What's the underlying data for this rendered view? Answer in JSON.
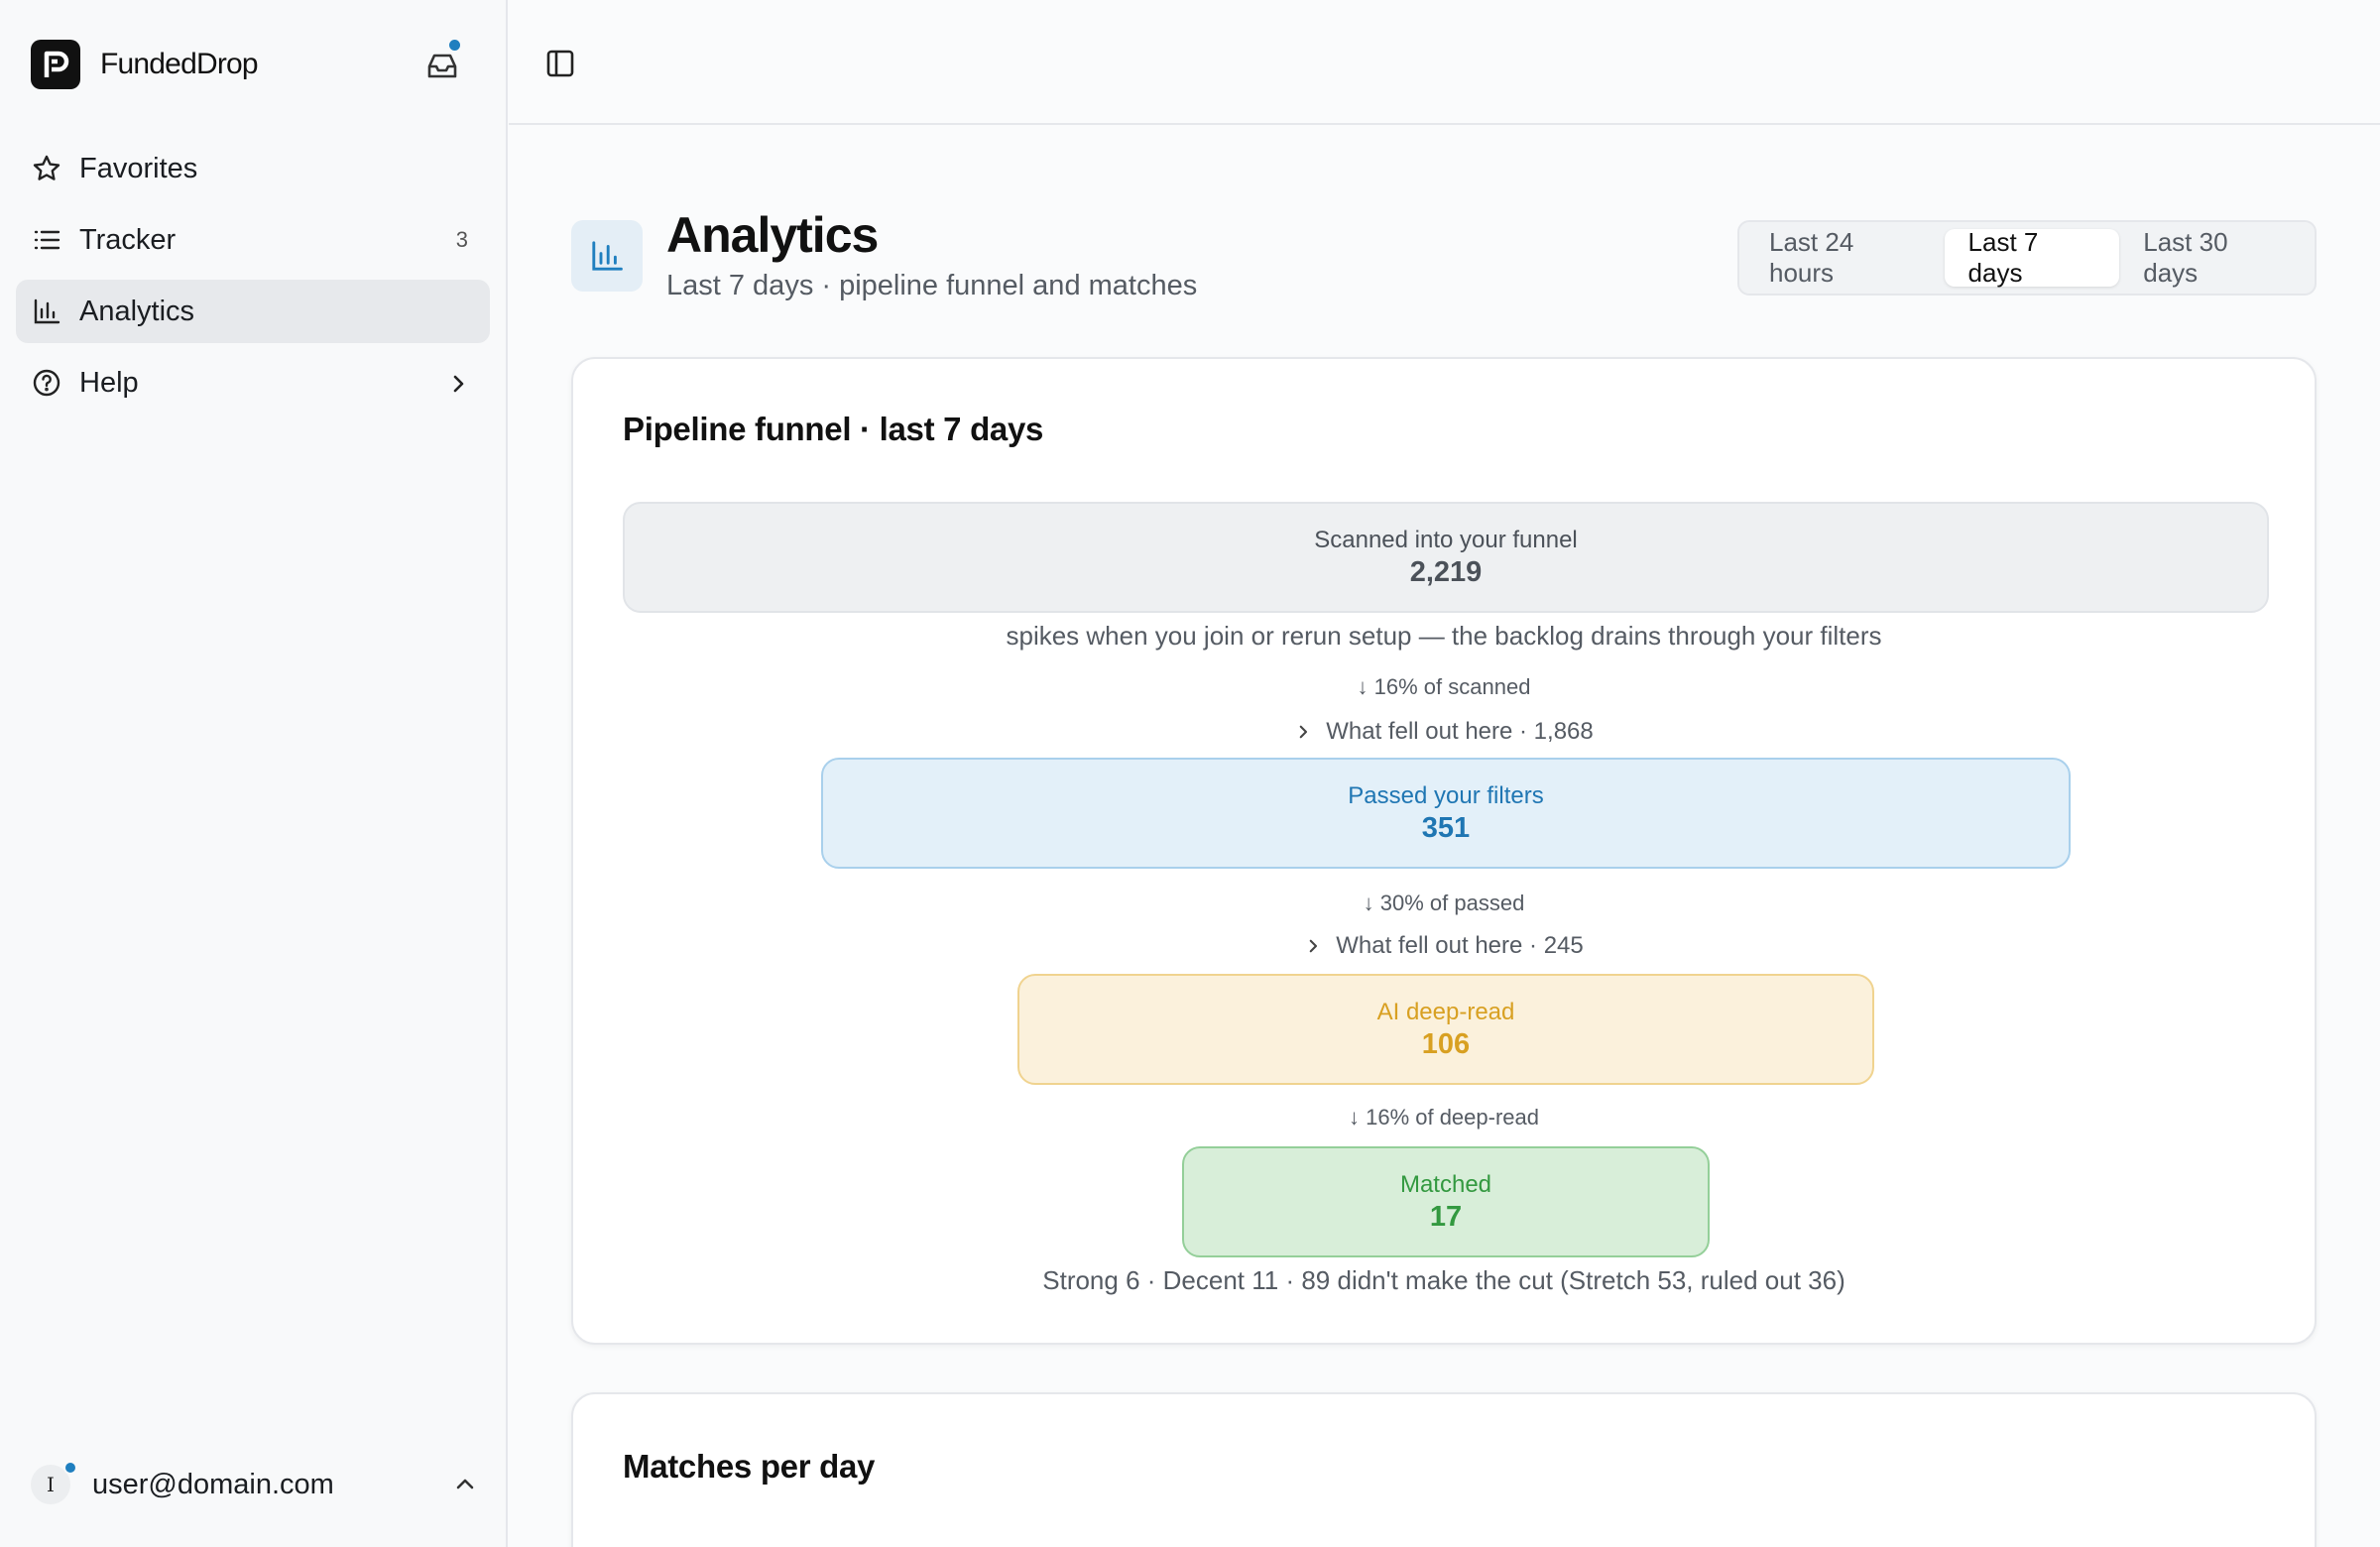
{
  "brand": {
    "name": "FundedDrop"
  },
  "icons": {
    "logo": "fundeddrop-logo",
    "inbox": "inbox-icon",
    "panel": "sidebar-toggle-icon"
  },
  "colors": {
    "accent": "#1f7fbf",
    "passed": "#1f76b3",
    "deep_read": "#d8a022",
    "matched": "#339940"
  },
  "sidebar": {
    "items": [
      {
        "label": "Favorites",
        "icon": "star-icon"
      },
      {
        "label": "Tracker",
        "icon": "list-icon",
        "count": "3"
      },
      {
        "label": "Analytics",
        "icon": "bar-chart-icon",
        "active": true
      },
      {
        "label": "Help",
        "icon": "help-circle-icon"
      }
    ]
  },
  "user": {
    "initial": "I",
    "email": "user@domain.com"
  },
  "header": {
    "title": "Analytics",
    "subtitle": "Last 7 days · pipeline funnel and matches",
    "ranges": [
      "Last 24 hours",
      "Last 7 days",
      "Last 30 days"
    ],
    "selected_range": "Last 7 days"
  },
  "funnel": {
    "title": "Pipeline funnel · last 7 days",
    "stages": [
      {
        "label": "Scanned into your funnel",
        "value": "2,219"
      },
      {
        "label": "Passed your filters",
        "value": "351"
      },
      {
        "label": "AI deep-read",
        "value": "106"
      },
      {
        "label": "Matched",
        "value": "17"
      }
    ],
    "scanned_note": "spikes when you join or rerun setup — the backlog drains through your filters",
    "pct_scanned": "↓ 16% of scanned",
    "fell_1": "What fell out here · 1,868",
    "pct_passed": "↓ 30% of passed",
    "fell_2": "What fell out here · 245",
    "pct_deep_read": "↓ 16% of deep-read",
    "summary": "Strong 6 · Decent 11 · 89 didn't make the cut (Stretch 53, ruled out 36)"
  },
  "matches_card": {
    "title": "Matches per day"
  }
}
